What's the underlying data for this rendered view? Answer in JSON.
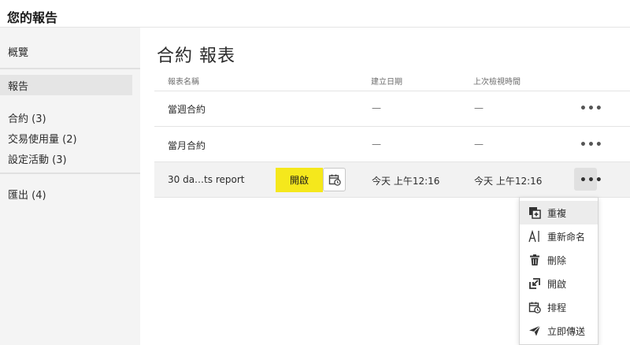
{
  "app": {
    "title": "您的報告"
  },
  "sidebar": {
    "items": [
      {
        "label": "概覽"
      },
      {
        "label": "報告"
      },
      {
        "label": "合約 (3)"
      },
      {
        "label": "交易使用量 (2)"
      },
      {
        "label": "設定活動 (3)"
      },
      {
        "label": "匯出 (4)"
      }
    ]
  },
  "main": {
    "title": "合約 報表",
    "columns": [
      "報表名稱",
      "建立日期",
      "上次檢視時間"
    ],
    "rows": [
      {
        "name": "當週合約",
        "created": "—",
        "last_viewed": "—"
      },
      {
        "name": "當月合約",
        "created": "—",
        "last_viewed": "—"
      },
      {
        "name": "30 da…ts report",
        "created": "今天 上午12:16",
        "last_viewed": "今天 上午12:16"
      }
    ],
    "open_button": "開啟",
    "more_glyph": "•••"
  },
  "menu": {
    "items": [
      {
        "label": "重複",
        "icon": "duplicate-icon"
      },
      {
        "label": "重新命名",
        "icon": "rename-icon"
      },
      {
        "label": "刪除",
        "icon": "trash-icon"
      },
      {
        "label": "開啟",
        "icon": "open-icon"
      },
      {
        "label": "排程",
        "icon": "calendar-icon"
      },
      {
        "label": "立即傳送",
        "icon": "send-icon"
      }
    ]
  },
  "colors": {
    "highlight": "#f5e81c",
    "sidebar_bg": "#f4f4f4",
    "selected_row": "#f2f2f2"
  }
}
